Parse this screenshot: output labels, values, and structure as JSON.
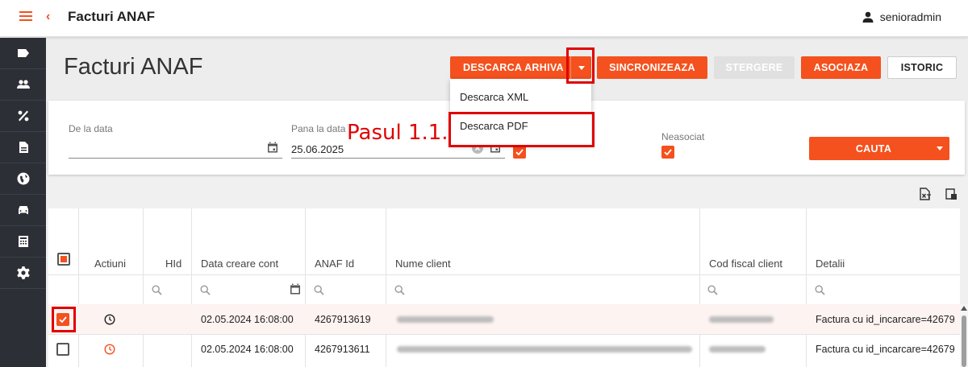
{
  "app": {
    "title": "Facturi ANAF",
    "user": "senioradmin"
  },
  "sidebar": {
    "items": [
      {
        "icon": "label-icon"
      },
      {
        "icon": "people-icon"
      },
      {
        "icon": "percent-icon"
      },
      {
        "icon": "document-icon"
      },
      {
        "icon": "globe-icon"
      },
      {
        "icon": "car-icon"
      },
      {
        "icon": "calculator-icon"
      },
      {
        "icon": "gear-icon"
      }
    ]
  },
  "page": {
    "title": "Facturi ANAF"
  },
  "actions": {
    "download_archive": "DESCARCA ARHIVA",
    "sync": "SINCRONIZEAZA",
    "delete": "STERGERE",
    "associate": "ASOCIAZA",
    "history": "ISTORIC"
  },
  "dropdown": {
    "items": [
      "Descarca XML",
      "Descarca PDF"
    ]
  },
  "filters": {
    "from_label": "De la data",
    "from_value": "",
    "to_label": "Pana la data",
    "to_value": "25.06.2025",
    "unassociated_label": "Neasociat",
    "search_button": "CAUTA"
  },
  "annotation": {
    "step_text": "Pasul 1.1."
  },
  "table": {
    "columns": [
      "Actiuni",
      "HId",
      "Data creare cont",
      "ANAF Id",
      "Nume client",
      "Cod fiscal client",
      "Detalii"
    ],
    "rows": [
      {
        "selected": true,
        "date": "02.05.2024 16:08:00",
        "anaf_id": "4267913619",
        "details": "Factura cu id_incarcare=42679"
      },
      {
        "selected": false,
        "date": "02.05.2024 16:08:00",
        "anaf_id": "4267913611",
        "details": "Factura cu id_incarcare=42679"
      }
    ]
  },
  "colors": {
    "accent": "#f4511e",
    "sidebar": "#2d2f36",
    "annotation": "#e00000"
  }
}
